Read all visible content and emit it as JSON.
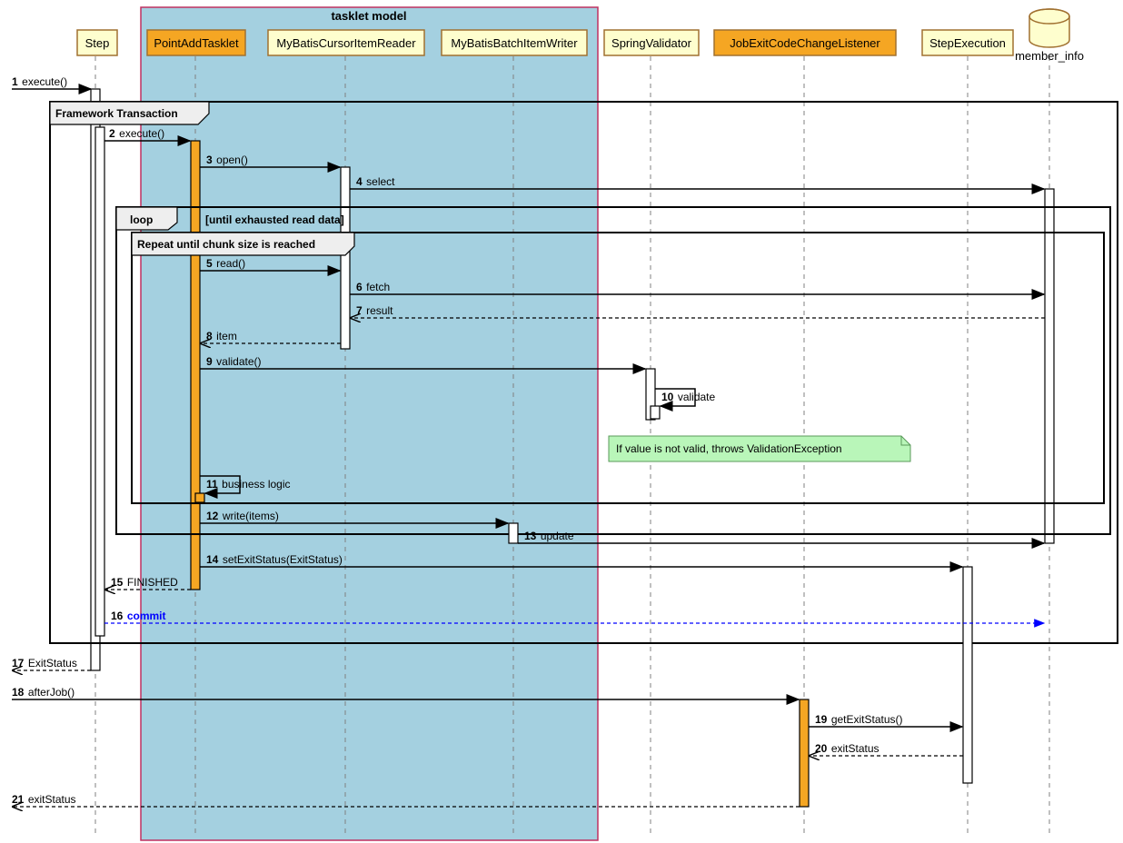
{
  "region_title": "tasklet model",
  "participants": {
    "step": "Step",
    "tasklet": "PointAddTasklet",
    "reader": "MyBatisCursorItemReader",
    "writer": "MyBatisBatchItemWriter",
    "validator": "SpringValidator",
    "listener": "JobExitCodeChangeListener",
    "stepexec": "StepExecution",
    "db": "member_info"
  },
  "frames": {
    "framework": "Framework Transaction",
    "loop": "loop",
    "loop_cond": "[until exhausted read data]",
    "repeat": "Repeat until chunk size is reached"
  },
  "messages": {
    "m1": {
      "n": "1",
      "t": "execute()"
    },
    "m2": {
      "n": "2",
      "t": "execute()"
    },
    "m3": {
      "n": "3",
      "t": "open()"
    },
    "m4": {
      "n": "4",
      "t": "select"
    },
    "m5": {
      "n": "5",
      "t": "read()"
    },
    "m6": {
      "n": "6",
      "t": "fetch"
    },
    "m7": {
      "n": "7",
      "t": "result"
    },
    "m8": {
      "n": "8",
      "t": "item"
    },
    "m9": {
      "n": "9",
      "t": "validate()"
    },
    "m10": {
      "n": "10",
      "t": "validate"
    },
    "m11": {
      "n": "11",
      "t": "business logic"
    },
    "m12": {
      "n": "12",
      "t": "write(items)"
    },
    "m13": {
      "n": "13",
      "t": "update"
    },
    "m14": {
      "n": "14",
      "t": "setExitStatus(ExitStatus)"
    },
    "m15": {
      "n": "15",
      "t": "FINISHED"
    },
    "m16": {
      "n": "16",
      "t": "commit"
    },
    "m17": {
      "n": "17",
      "t": "ExitStatus"
    },
    "m18": {
      "n": "18",
      "t": "afterJob()"
    },
    "m19": {
      "n": "19",
      "t": "getExitStatus()"
    },
    "m20": {
      "n": "20",
      "t": "exitStatus"
    },
    "m21": {
      "n": "21",
      "t": "exitStatus"
    }
  },
  "note": "If value is not valid, throws ValidationException"
}
